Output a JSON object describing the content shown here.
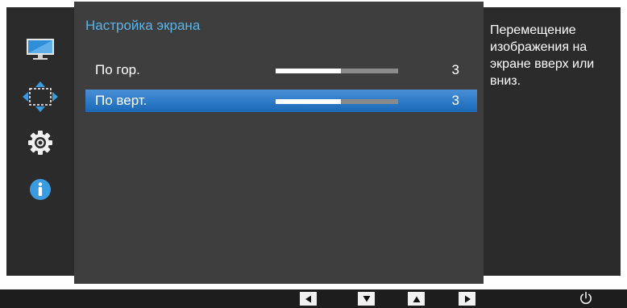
{
  "sidebar": {
    "items": [
      {
        "icon": "monitor-icon"
      },
      {
        "icon": "position-arrows-icon"
      },
      {
        "icon": "gear-icon"
      },
      {
        "icon": "info-icon"
      }
    ]
  },
  "menu": {
    "title": "Настройка экрана",
    "rows": [
      {
        "label": "По гор.",
        "value": "3",
        "level": 0.53,
        "selected": false
      },
      {
        "label": "По верт.",
        "value": "3",
        "level": 0.53,
        "selected": true
      }
    ]
  },
  "help": {
    "text": "Перемещение изображения на экране вверх или вниз."
  },
  "bottom_bar": {
    "buttons": [
      "left-arrow-icon",
      "down-arrow-icon",
      "up-arrow-icon",
      "right-arrow-icon",
      "power-icon"
    ]
  },
  "colors": {
    "accent": "#5ab4ea",
    "selected_row": "#2f7cc9"
  }
}
